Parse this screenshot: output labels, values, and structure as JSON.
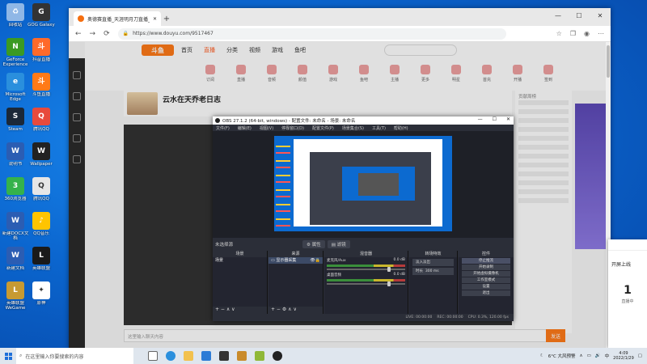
{
  "desktop": {
    "icons": [
      {
        "label": "回收站",
        "color": "#8fb7e6",
        "glyph": "♻"
      },
      {
        "label": "GOG Galaxy",
        "color": "#333333",
        "glyph": "G"
      },
      {
        "label": "GeForce Experience",
        "color": "#3b9a22",
        "glyph": "N"
      },
      {
        "label": "抖音直播",
        "color": "#ff6a2a",
        "glyph": "斗"
      },
      {
        "label": "Microsoft Edge",
        "color": "#2a8fdd",
        "glyph": "e"
      },
      {
        "label": "斗鱼直播",
        "color": "#ff7a18",
        "glyph": "斗"
      },
      {
        "label": "Steam",
        "color": "#1b2838",
        "glyph": "S"
      },
      {
        "label": "腾讯QQ",
        "color": "#e84a3c",
        "glyph": "Q"
      },
      {
        "label": "说明书",
        "color": "#2b5db3",
        "glyph": "W"
      },
      {
        "label": "Wallpaper",
        "color": "#222222",
        "glyph": "W"
      },
      {
        "label": "360浏览器",
        "color": "#35b24b",
        "glyph": "3"
      },
      {
        "label": "腾讯QQ",
        "color": "#e6e6e6",
        "glyph": "Q"
      },
      {
        "label": "新建DOCX文档",
        "color": "#2b5db3",
        "glyph": "W"
      },
      {
        "label": "QQ音乐",
        "color": "#ffc400",
        "glyph": "♪"
      },
      {
        "label": "新建文档",
        "color": "#2b5db3",
        "glyph": "W"
      },
      {
        "label": "英雄联盟",
        "color": "#1a1a1a",
        "glyph": "L"
      },
      {
        "label": "英雄联盟WeGame",
        "color": "#c79a32",
        "glyph": "L"
      },
      {
        "label": "原神",
        "color": "#ffffff",
        "glyph": "✦"
      }
    ]
  },
  "browser": {
    "tab_title": "奥德赛直播_天涯明月刀直播_斗鱼",
    "new_tab": "+",
    "url": "https://www.douyu.com/9517467",
    "win_min": "—",
    "win_max": "☐",
    "win_close": "✕",
    "back": "←",
    "forward": "→",
    "refresh": "⟳"
  },
  "douyu": {
    "logo": "斗鱼",
    "nav": [
      "首页",
      "直播",
      "分类",
      "视频",
      "游戏",
      "鱼吧"
    ],
    "active_nav": "直播",
    "categories": [
      "订阅",
      "直播",
      "音频",
      "颜值",
      "游戏",
      "鱼吧",
      "主播",
      "更多",
      "明星",
      "首充",
      "开播",
      "签到"
    ],
    "room_title": "云水在天乔老日志",
    "chat_placeholder": "这里输入聊天内容",
    "send": "发送",
    "right_panel_text": "贡献周榜"
  },
  "obs": {
    "title": "OBS 27.1.2 (64-bit, windows) - 配置文件: 未命名 - 场景: 未命名",
    "menu": [
      "文件(F)",
      "编辑(E)",
      "视图(V)",
      "停靠窗口(D)",
      "配置文件(P)",
      "场景集合(S)",
      "工具(T)",
      "帮助(H)"
    ],
    "no_source": "未选择源",
    "properties": "属性",
    "filters": "滤镜",
    "docks": {
      "scenes": {
        "title": "场景",
        "items": [
          "场景"
        ]
      },
      "sources": {
        "title": "来源",
        "items": [
          "显示器采集"
        ]
      },
      "mixer": {
        "title": "混音器",
        "rows": [
          {
            "name": "麦克风/Aux",
            "db": "0.0 dB"
          },
          {
            "name": "桌面音频",
            "db": "0.0 dB"
          }
        ]
      },
      "transitions": {
        "title": "转场特效",
        "type": "淡入淡出",
        "duration_label": "时长",
        "duration": "300 ms"
      },
      "controls": {
        "title": "控件",
        "buttons": [
          "停止推流",
          "开始录制",
          "开始虚拟摄像机",
          "工作室模式",
          "设置",
          "退出"
        ]
      }
    },
    "status": {
      "live": "LIVE: 00:00:00",
      "rec": "REC: 00:00:00",
      "cpu": "CPU: 0.3%, 120.00 fps"
    }
  },
  "notification": {
    "text": "开屏上线",
    "number": "1",
    "sub": "直播中"
  },
  "taskbar": {
    "search_placeholder": "在这里输入你要搜索的内容",
    "weather": "6°C 大风预警",
    "time": "4:09",
    "date": "2022/1/29",
    "lang": "中"
  }
}
